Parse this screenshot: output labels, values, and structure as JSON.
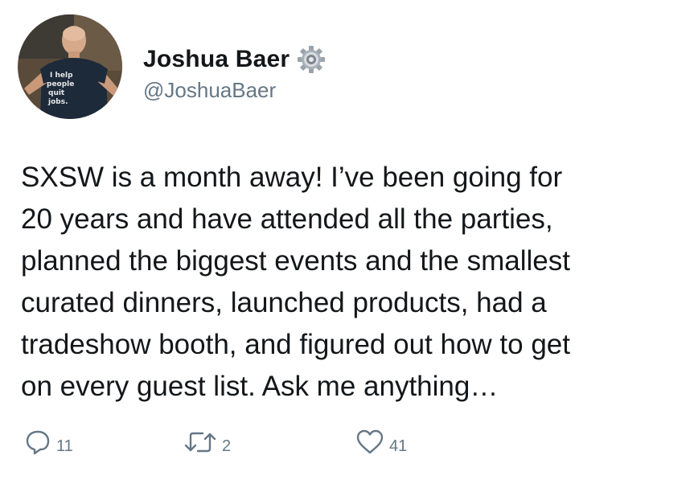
{
  "author": {
    "display_name": "Joshua Baer",
    "handle": "@JoshuaBaer",
    "avatar_shirt_text": "I help people quit jobs.",
    "badge_icon": "gear-icon"
  },
  "tweet": {
    "lines": [
      "SXSW is a month away! I’ve been going for",
      "20 years and have attended all the parties,",
      "planned the biggest events and the smallest",
      "curated dinners, launched products, had a",
      "tradeshow booth, and figured out how to get",
      "on every guest list. Ask me anything…"
    ]
  },
  "actions": {
    "reply": {
      "icon": "reply-icon",
      "count": "11"
    },
    "retweet": {
      "icon": "retweet-icon",
      "count": "2"
    },
    "like": {
      "icon": "heart-icon",
      "count": "41"
    }
  },
  "colors": {
    "text": "#14171a",
    "muted": "#657786"
  }
}
